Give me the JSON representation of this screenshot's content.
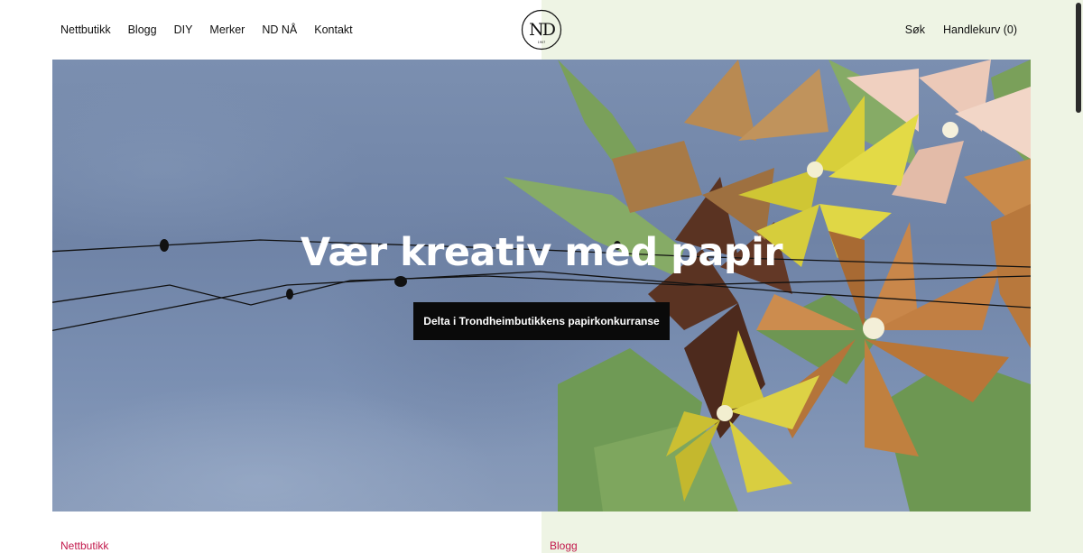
{
  "nav": {
    "left": [
      {
        "label": "Nettbutikk"
      },
      {
        "label": "Blogg"
      },
      {
        "label": "DIY"
      },
      {
        "label": "Merker"
      },
      {
        "label": "ND NÅ"
      },
      {
        "label": "Kontakt"
      }
    ],
    "search_label": "Søk",
    "cart_label": "Handlekurv (0)"
  },
  "logo": {
    "letters": "ND",
    "year": "1907"
  },
  "hero": {
    "title": "Vær kreativ med papir",
    "cta_label": "Delta i Trondheimbutikkens papirkonkurranse"
  },
  "sections": {
    "left_label": "Nettbutikk",
    "right_label": "Blogg"
  },
  "colors": {
    "accent": "#c2184b",
    "right_panel_bg": "#eef4e4",
    "cta_bg": "#0a0a0a"
  }
}
